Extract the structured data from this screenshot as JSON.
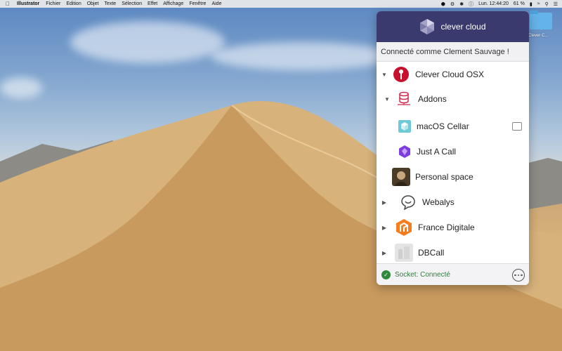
{
  "menubar": {
    "app": "Illustrator",
    "items": [
      "Fichier",
      "Edition",
      "Objet",
      "Texte",
      "Sélection",
      "Effet",
      "Affichage",
      "Fenêtre",
      "Aide"
    ],
    "battery": "61 %",
    "clock": "Lun. 12:44:20"
  },
  "desktop": {
    "folder_label": "Clever C..."
  },
  "panel": {
    "brand": "clever cloud",
    "connected_as": "Connecté comme Clement Sauvage !",
    "rows": [
      {
        "label": "Clever Cloud OSX",
        "expand": "down"
      },
      {
        "label": "Addons",
        "expand": "down"
      },
      {
        "label": "macOS Cellar",
        "expand": "none"
      },
      {
        "label": "Just A Call",
        "expand": "none"
      },
      {
        "label": "Personal space",
        "expand": "none"
      },
      {
        "label": "Webalys",
        "expand": "right"
      },
      {
        "label": "France Digitale",
        "expand": "right"
      },
      {
        "label": "DBCall",
        "expand": "right"
      }
    ],
    "footer_status": "Socket: Connecté"
  },
  "colors": {
    "header": "#3b3a6e",
    "accent_orange": "#f57c1f",
    "status_green": "#2f8a3b"
  }
}
